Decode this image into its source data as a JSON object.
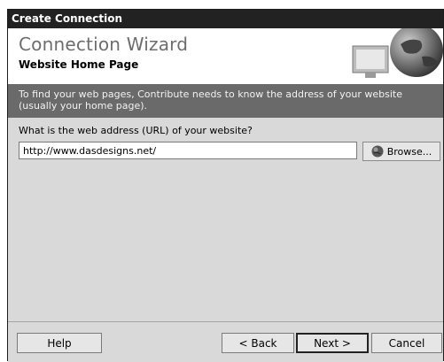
{
  "window": {
    "title": "Create Connection"
  },
  "banner": {
    "title": "Connection Wizard",
    "subtitle": "Website Home Page",
    "icon": "globe-monitor-icon"
  },
  "info": {
    "text": "To find your web pages, Contribute needs to know the address of your website (usually your home page)."
  },
  "form": {
    "question": "What is the web address (URL) of your website?",
    "url_value": "http://www.dasdesigns.net/",
    "browse_label": "Browse...",
    "browse_icon": "globe-icon"
  },
  "footer": {
    "help_label": "Help",
    "back_label": "< Back",
    "next_label": "Next >",
    "cancel_label": "Cancel"
  }
}
